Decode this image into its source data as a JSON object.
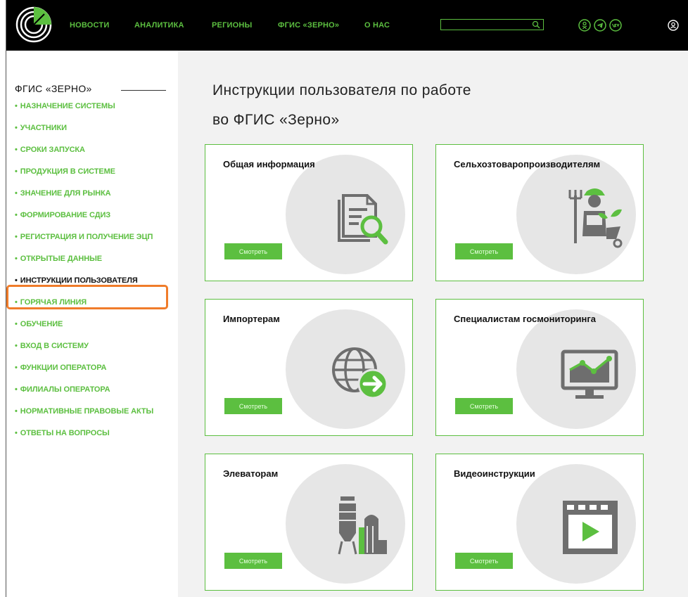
{
  "header": {
    "nav": [
      {
        "id": "news",
        "label": "НОВОСТИ"
      },
      {
        "id": "analytics",
        "label": "АНАЛИТИКА"
      },
      {
        "id": "regions",
        "label": "РЕГИОНЫ"
      },
      {
        "id": "fgis",
        "label": "ФГИС «ЗЕРНО»"
      },
      {
        "id": "about",
        "label": "О НАС"
      }
    ],
    "search": {
      "value": "",
      "placeholder": ""
    },
    "social_icons": [
      "odnoklassniki-icon",
      "telegram-icon",
      "vk-icon"
    ],
    "user_icon": "user-icon"
  },
  "sidebar": {
    "title": "ФГИС «ЗЕРНО»",
    "items": [
      {
        "label": "НАЗНАЧЕНИЕ СИСТЕМЫ",
        "active": false
      },
      {
        "label": "УЧАСТНИКИ",
        "active": false
      },
      {
        "label": "СРОКИ ЗАПУСКА",
        "active": false
      },
      {
        "label": "ПРОДУКЦИЯ В СИСТЕМЕ",
        "active": false
      },
      {
        "label": "ЗНАЧЕНИЕ ДЛЯ РЫНКА",
        "active": false
      },
      {
        "label": "ФОРМИРОВАНИЕ СДИЗ",
        "active": false
      },
      {
        "label": "РЕГИСТРАЦИЯ И ПОЛУЧЕНИЕ ЭЦП",
        "active": false
      },
      {
        "label": "ОТКРЫТЫЕ ДАННЫЕ",
        "active": false
      },
      {
        "label": "ИНСТРУКЦИИ ПОЛЬЗОВАТЕЛЯ",
        "active": true
      },
      {
        "label": "ГОРЯЧАЯ ЛИНИЯ",
        "active": false
      },
      {
        "label": "ОБУЧЕНИЕ",
        "active": false
      },
      {
        "label": "ВХОД В СИСТЕМУ",
        "active": false
      },
      {
        "label": "ФУНКЦИИ ОПЕРАТОРА",
        "active": false
      },
      {
        "label": "ФИЛИАЛЫ ОПЕРАТОРА",
        "active": false
      },
      {
        "label": "НОРМАТИВНЫЕ ПРАВОВЫЕ АКТЫ",
        "active": false
      },
      {
        "label": "ОТВЕТЫ НА ВОПРОСЫ",
        "active": false
      }
    ]
  },
  "main": {
    "title_line1": "Инструкции пользователя по работе",
    "title_line2": "во ФГИС «Зерно»",
    "button_label": "Смотреть",
    "cards": [
      {
        "title": "Общая информация",
        "icon": "document-search-icon"
      },
      {
        "title": "Сельхозтоваропроизводителям",
        "icon": "farmer-icon"
      },
      {
        "title": "Импортерам",
        "icon": "globe-arrow-icon"
      },
      {
        "title": "Специалистам госмониторинга",
        "icon": "monitor-chart-icon"
      },
      {
        "title": "Элеваторам",
        "icon": "elevator-silo-icon"
      },
      {
        "title": "Видеоинструкции",
        "icon": "video-play-icon"
      }
    ]
  },
  "colors": {
    "accent": "#5cbf40",
    "header_bg": "#000000",
    "highlight": "#f07c2a",
    "icon_gray": "#6e6e6e"
  }
}
